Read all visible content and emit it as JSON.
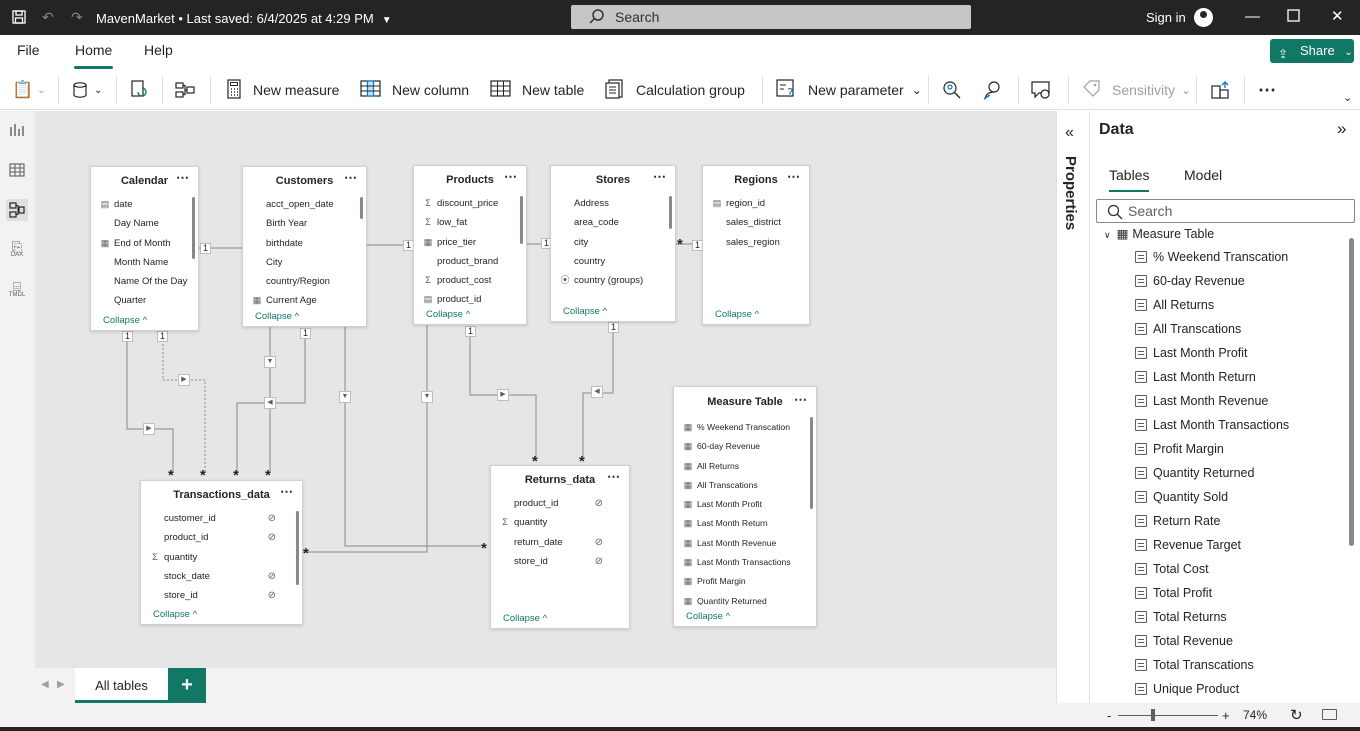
{
  "titlebar": {
    "app_title": "MavenMarket • Last saved: 6/4/2025 at 4:29 PM",
    "search_placeholder": "Search",
    "signin": "Sign in"
  },
  "menu": {
    "file": "File",
    "home": "Home",
    "help": "Help",
    "share": "Share"
  },
  "ribbon": {
    "new_measure": "New measure",
    "new_column": "New column",
    "new_table": "New table",
    "calculation_group": "Calculation group",
    "new_parameter": "New parameter",
    "sensitivity": "Sensitivity"
  },
  "leftnav": {
    "dax": "DAX",
    "tmdl": "TMDL"
  },
  "tables": {
    "calendar": {
      "title": "Calendar",
      "fields": [
        "date",
        "Day Name",
        "End of Month",
        "Month Name",
        "Name Of the Day",
        "Quarter"
      ],
      "collapse": "Collapse ^"
    },
    "customers": {
      "title": "Customers",
      "fields": [
        "acct_open_date",
        "Birth Year",
        "birthdate",
        "City",
        "country/Region",
        "Current Age"
      ],
      "collapse": "Collapse ^"
    },
    "products": {
      "title": "Products",
      "fields": [
        "discount_price",
        "low_fat",
        "price_tier",
        "product_brand",
        "product_cost",
        "product_id"
      ],
      "collapse": "Collapse ^"
    },
    "stores": {
      "title": "Stores",
      "fields": [
        "Address",
        "area_code",
        "city",
        "country",
        "country (groups)"
      ],
      "collapse": "Collapse ^"
    },
    "regions": {
      "title": "Regions",
      "fields": [
        "region_id",
        "sales_district",
        "sales_region"
      ],
      "collapse": "Collapse ^"
    },
    "transactions": {
      "title": "Transactions_data",
      "fields": [
        "customer_id",
        "product_id",
        "quantity",
        "stock_date",
        "store_id"
      ],
      "collapse": "Collapse ^"
    },
    "returns": {
      "title": "Returns_data",
      "fields": [
        "product_id",
        "quantity",
        "return_date",
        "store_id"
      ],
      "collapse": "Collapse ^"
    },
    "measure": {
      "title": "Measure Table",
      "fields": [
        "% Weekend Transcation",
        "60-day Revenue",
        "All Returns",
        "All Transcations",
        "Last Month Profit",
        "Last Month Return",
        "Last Month Revenue",
        "Last Month Transactions",
        "Profit Margin",
        "Quantity Returned"
      ],
      "collapse": "Collapse ^"
    }
  },
  "relationships": {
    "one": "1",
    "many": "*"
  },
  "canvas_tabs": {
    "all_tables": "All tables",
    "add": "+"
  },
  "status": {
    "zoom": "74%",
    "minus": "-",
    "plus": "+"
  },
  "properties": {
    "title": "Properties"
  },
  "data_pane": {
    "title": "Data",
    "tab_tables": "Tables",
    "tab_model": "Model",
    "search_placeholder": "Search",
    "measure_table": "Measure Table",
    "measures": [
      "% Weekend Transcation",
      "60-day Revenue",
      "All Returns",
      "All Transcations",
      "Last Month Profit",
      "Last Month Return",
      "Last Month Revenue",
      "Last Month Transactions",
      "Profit Margin",
      "Quantity Returned",
      "Quantity Sold",
      "Return Rate",
      "Revenue Target",
      "Total Cost",
      "Total Profit",
      "Total Returns",
      "Total Revenue",
      "Total Transcations",
      "Unique Product"
    ]
  },
  "colors": {
    "accent": "#117865",
    "titlebar": "#252423",
    "canvas": "#e6e6e6"
  }
}
